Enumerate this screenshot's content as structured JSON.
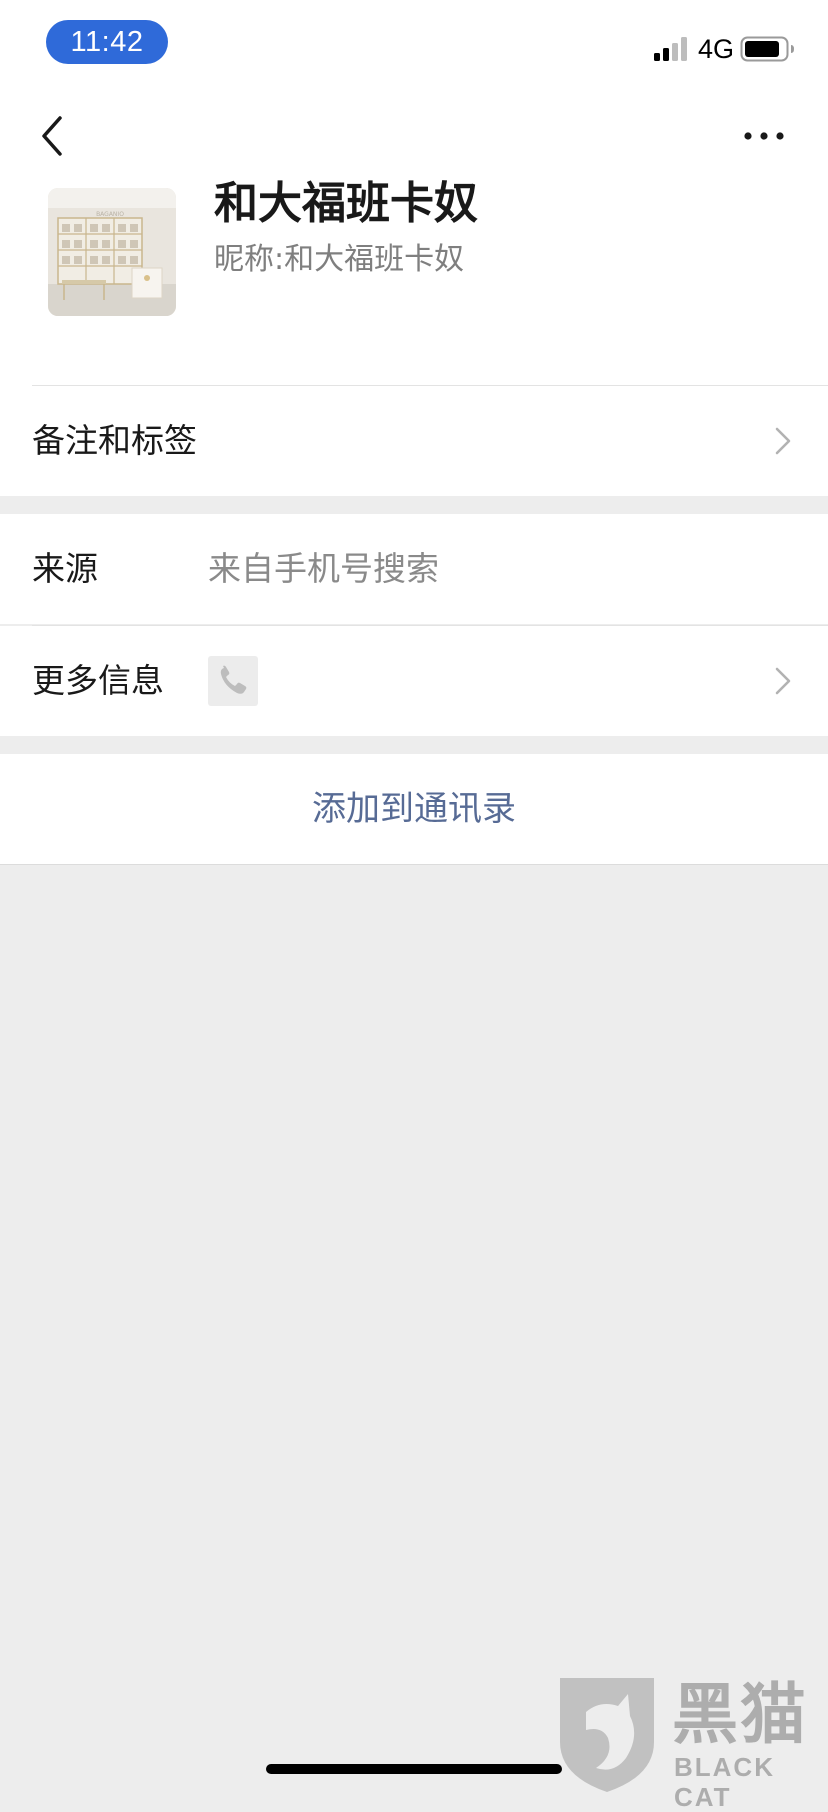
{
  "status_bar": {
    "time": "11:42",
    "network": "4G",
    "signal_icon": "cellular-signal-icon",
    "battery_icon": "battery-icon"
  },
  "nav": {
    "back_icon": "chevron-left-icon",
    "more_icon": "ellipsis-icon"
  },
  "profile": {
    "name": "和大福班卡奴",
    "nickname_label": "昵称:",
    "nickname": "和大福班卡奴",
    "avatar_sign": "BAGANIO"
  },
  "cells": {
    "remarks_tags": {
      "label": "备注和标签"
    },
    "source": {
      "label": "来源",
      "value": "来自手机号搜索"
    },
    "more_info": {
      "label": "更多信息",
      "icon": "phone-icon"
    }
  },
  "actions": {
    "add_to_contacts": "添加到通讯录"
  },
  "watermark": {
    "logo_icon": "black-cat-logo-icon",
    "text": "黑猫",
    "sub": "BLACK CAT"
  },
  "colors": {
    "link": "#576b95",
    "time_pill": "#2f6ad9",
    "background": "#ededed"
  }
}
